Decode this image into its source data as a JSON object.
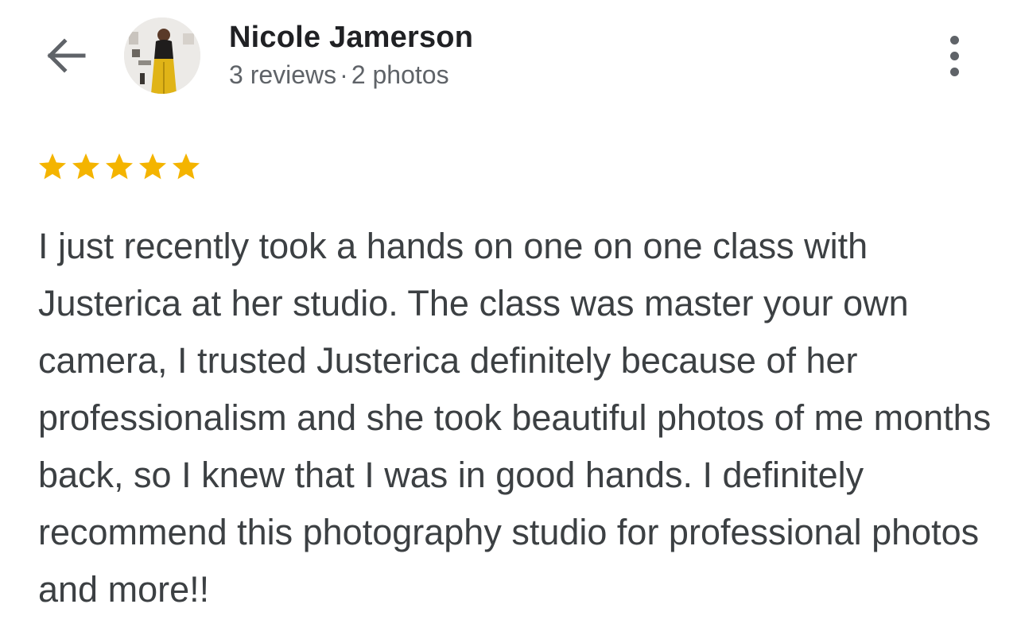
{
  "header": {
    "reviewer_name": "Nicole Jamerson",
    "reviews_count": "3 reviews",
    "separator": "·",
    "photos_count": "2 photos",
    "back_icon": "arrow-back-icon",
    "more_icon": "more-vert-icon"
  },
  "review": {
    "rating": 5,
    "rating_max": 5,
    "star_color": "#f4b400",
    "text": "I just recently took a hands on one on one class with Justerica at her studio. The class was master your own camera, I trusted Justerica definitely because of her professionalism and she took beautiful photos of me months back, so I knew that I was in good hands. I definitely recommend this photography studio for professional photos and more!!"
  }
}
